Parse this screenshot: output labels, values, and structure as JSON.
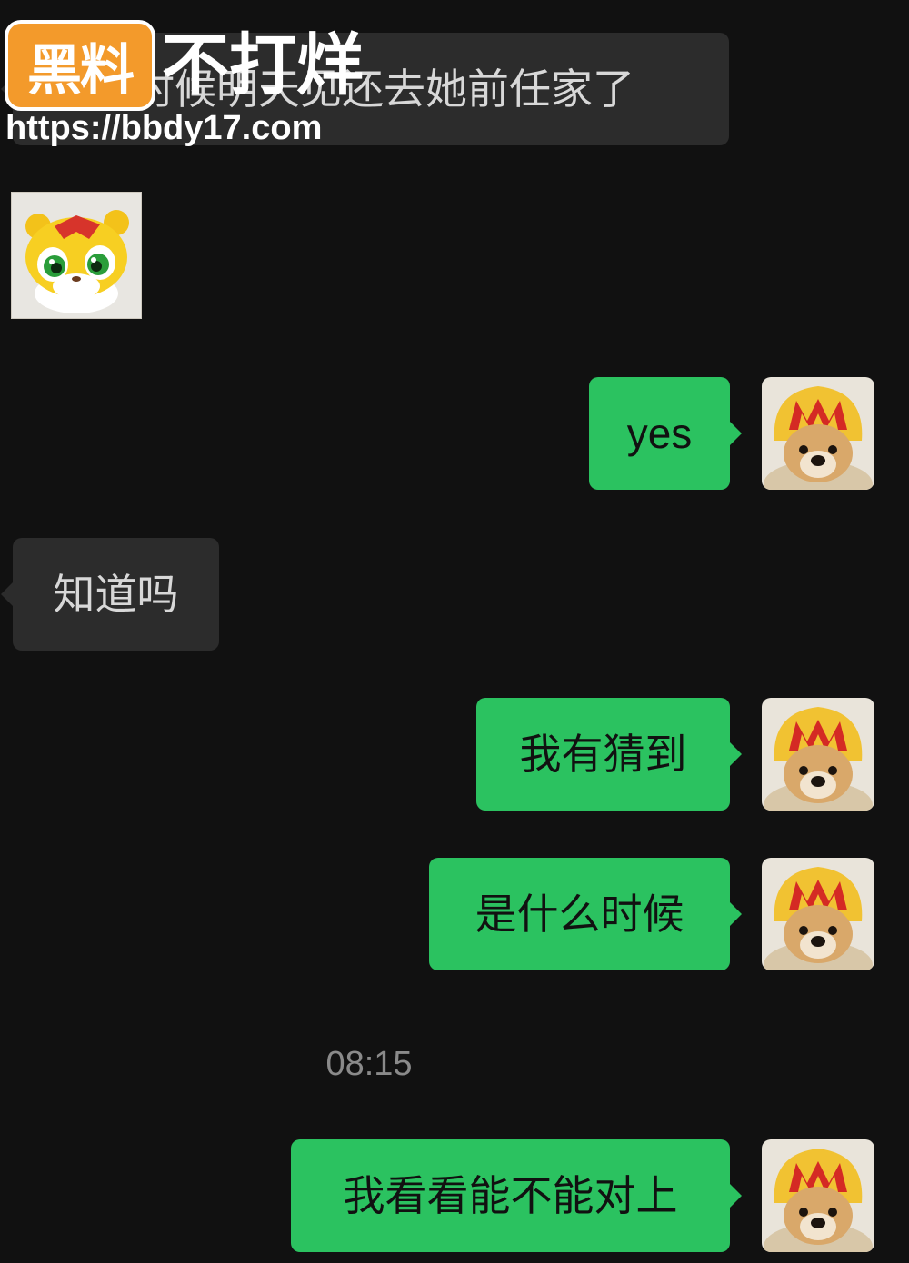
{
  "watermark": {
    "badge": "黑料",
    "text": "不打烊",
    "url": "https://bbdy17.com"
  },
  "colors": {
    "background": "#111111",
    "incoming_bubble": "#2c2c2c",
    "outgoing_bubble": "#2bc260"
  },
  "messages": {
    "m0": "那个时候明天见还去她前任家了",
    "m1_sticker": "tiger-cartoon-sticker",
    "m2": "yes",
    "m3": "知道吗",
    "m4": "我有猜到",
    "m5": "是什么时候",
    "timestamp": "08:15",
    "m6": "我看看能不能对上"
  },
  "icons": {
    "self_avatar": "dog-mcdonalds-hat-avatar",
    "sticker": "tiger-cartoon-sticker"
  }
}
